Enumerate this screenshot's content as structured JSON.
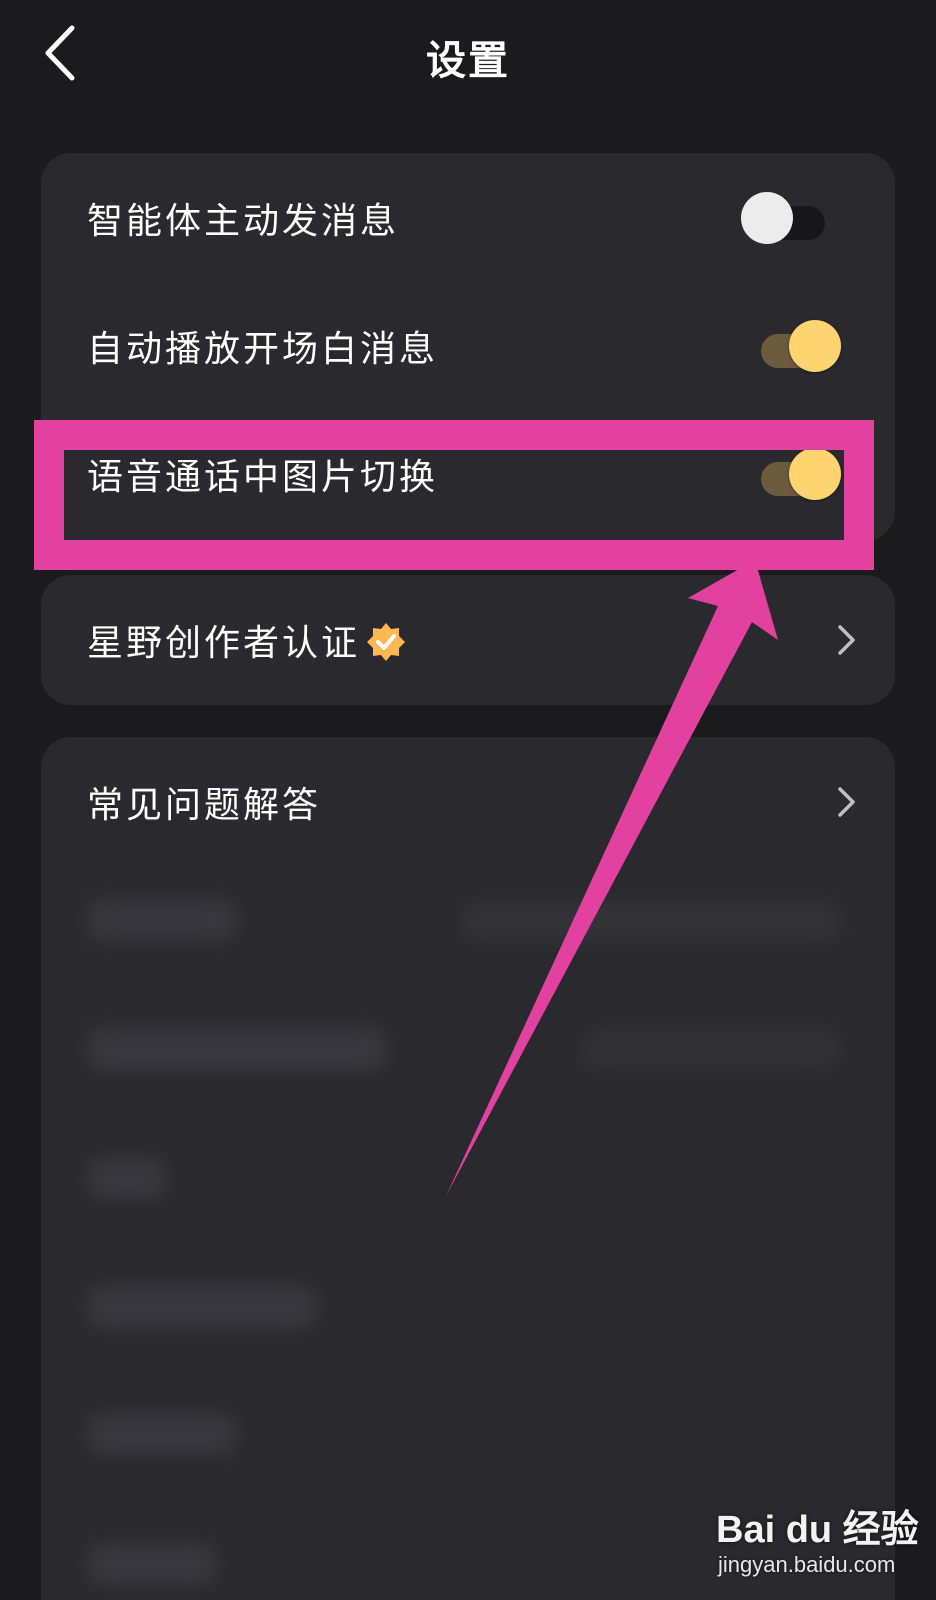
{
  "header": {
    "title": "设置",
    "back_icon": "chevron-left-icon"
  },
  "toggles": [
    {
      "label": "智能体主动发消息",
      "state": "off"
    },
    {
      "label": "自动播放开场白消息",
      "state": "on"
    },
    {
      "label": "语音通话中图片切换",
      "state": "on"
    }
  ],
  "creator": {
    "label": "星野创作者认证",
    "badge_icon": "verified-badge-icon"
  },
  "faq": {
    "label": "常见问题解答"
  },
  "colors": {
    "background": "#1b1b1e",
    "card": "#2a2a2e",
    "toggle_on": "#fed470",
    "toggle_on_track": "#6c5b3c",
    "highlight": "#e2419f"
  },
  "watermark": {
    "brand": "Bai du 经验",
    "url": "jingyan.baidu.com"
  }
}
